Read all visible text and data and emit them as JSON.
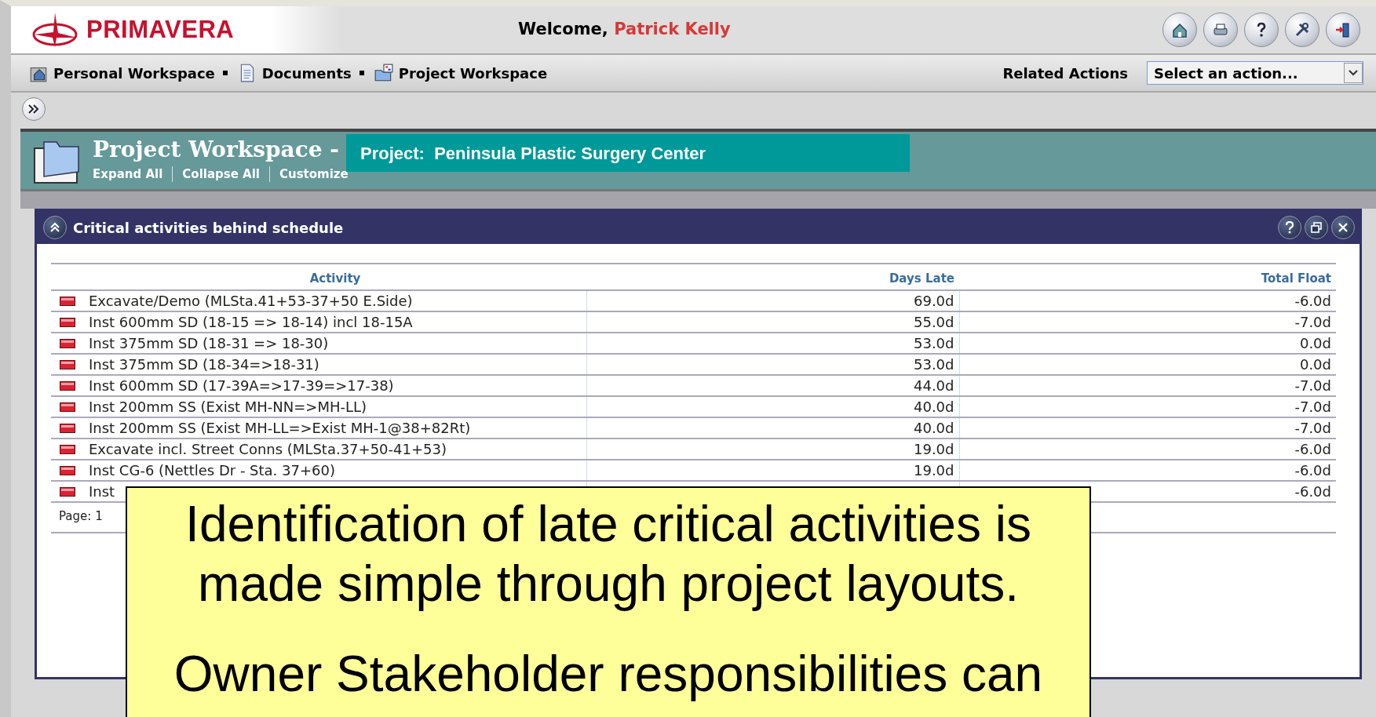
{
  "header": {
    "logo": "PRIMAVERA",
    "welcome": "Welcome,",
    "user": "Patrick Kelly"
  },
  "nav": [
    {
      "label": "Personal Workspace",
      "kind": "home"
    },
    {
      "label": "Documents",
      "kind": "document"
    },
    {
      "label": "Project Workspace",
      "kind": "folder"
    }
  ],
  "related_actions": {
    "label": "Related Actions",
    "value": "Select an action..."
  },
  "workspace": {
    "title": "Project Workspace -",
    "links": [
      "Expand All",
      "Collapse All",
      "Customize"
    ],
    "project_banner": "Project:  Peninsula Plastic Surgery Center"
  },
  "portlet": {
    "title": "Critical activities behind schedule",
    "table": {
      "columns": [
        "Activity",
        "Days Late",
        "Total Float"
      ],
      "rows": [
        {
          "activity": "Excavate/Demo (MLSta.41+53-37+50 E.Side)",
          "days_late": "69.0d",
          "total_float": "-6.0d"
        },
        {
          "activity": "Inst 600mm SD (18-15 => 18-14) incl 18-15A",
          "days_late": "55.0d",
          "total_float": "-7.0d"
        },
        {
          "activity": "Inst 375mm SD (18-31 => 18-30)",
          "days_late": "53.0d",
          "total_float": "0.0d"
        },
        {
          "activity": "Inst 375mm SD (18-34=>18-31)",
          "days_late": "53.0d",
          "total_float": "0.0d"
        },
        {
          "activity": "Inst 600mm SD (17-39A=>17-39=>17-38)",
          "days_late": "44.0d",
          "total_float": "-7.0d"
        },
        {
          "activity": "Inst 200mm SS (Exist MH-NN=>MH-LL)",
          "days_late": "40.0d",
          "total_float": "-7.0d"
        },
        {
          "activity": "Inst 200mm SS (Exist MH-LL=>Exist MH-1@38+82Rt)",
          "days_late": "40.0d",
          "total_float": "-7.0d"
        },
        {
          "activity": "Excavate incl. Street Conns (MLSta.37+50-41+53)",
          "days_late": "19.0d",
          "total_float": "-6.0d"
        },
        {
          "activity": "Inst CG-6 (Nettles Dr - Sta. 37+60)",
          "days_late": "19.0d",
          "total_float": "-6.0d"
        },
        {
          "activity": "Inst",
          "total_float": "-6.0d"
        }
      ]
    },
    "pager": "Page: 1"
  },
  "callout": {
    "paragraphs": [
      "Identification of late critical activities is made simple through project layouts.",
      "Owner Stakeholder responsibilities can"
    ]
  }
}
